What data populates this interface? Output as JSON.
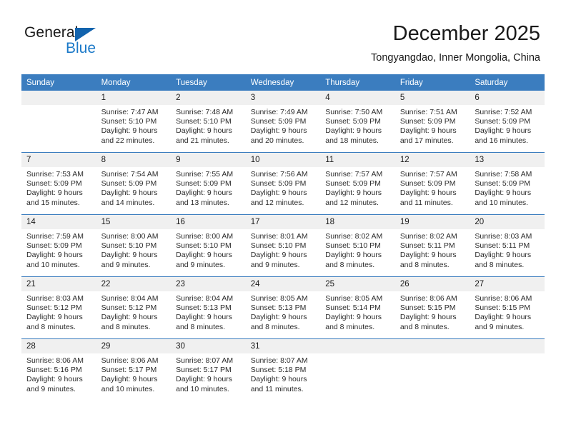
{
  "logo": {
    "word_one": "General",
    "word_two": "Blue",
    "triangle_color": "#1263ad",
    "blue_text_color": "#1b79c8"
  },
  "header": {
    "month_title": "December 2025",
    "location": "Tongyangdao, Inner Mongolia, China"
  },
  "theme": {
    "header_blue": "#3b7dbf",
    "daynum_band": "#f0f0f0",
    "text": "#2b2b2b"
  },
  "calendar": {
    "weekday_headers": [
      "Sunday",
      "Monday",
      "Tuesday",
      "Wednesday",
      "Thursday",
      "Friday",
      "Saturday"
    ],
    "weeks": [
      [
        {
          "day": "",
          "sunrise": "",
          "sunset": "",
          "daylight1": "",
          "daylight2": "",
          "empty": true
        },
        {
          "day": "1",
          "sunrise": "Sunrise: 7:47 AM",
          "sunset": "Sunset: 5:10 PM",
          "daylight1": "Daylight: 9 hours",
          "daylight2": "and 22 minutes."
        },
        {
          "day": "2",
          "sunrise": "Sunrise: 7:48 AM",
          "sunset": "Sunset: 5:10 PM",
          "daylight1": "Daylight: 9 hours",
          "daylight2": "and 21 minutes."
        },
        {
          "day": "3",
          "sunrise": "Sunrise: 7:49 AM",
          "sunset": "Sunset: 5:09 PM",
          "daylight1": "Daylight: 9 hours",
          "daylight2": "and 20 minutes."
        },
        {
          "day": "4",
          "sunrise": "Sunrise: 7:50 AM",
          "sunset": "Sunset: 5:09 PM",
          "daylight1": "Daylight: 9 hours",
          "daylight2": "and 18 minutes."
        },
        {
          "day": "5",
          "sunrise": "Sunrise: 7:51 AM",
          "sunset": "Sunset: 5:09 PM",
          "daylight1": "Daylight: 9 hours",
          "daylight2": "and 17 minutes."
        },
        {
          "day": "6",
          "sunrise": "Sunrise: 7:52 AM",
          "sunset": "Sunset: 5:09 PM",
          "daylight1": "Daylight: 9 hours",
          "daylight2": "and 16 minutes."
        }
      ],
      [
        {
          "day": "7",
          "sunrise": "Sunrise: 7:53 AM",
          "sunset": "Sunset: 5:09 PM",
          "daylight1": "Daylight: 9 hours",
          "daylight2": "and 15 minutes."
        },
        {
          "day": "8",
          "sunrise": "Sunrise: 7:54 AM",
          "sunset": "Sunset: 5:09 PM",
          "daylight1": "Daylight: 9 hours",
          "daylight2": "and 14 minutes."
        },
        {
          "day": "9",
          "sunrise": "Sunrise: 7:55 AM",
          "sunset": "Sunset: 5:09 PM",
          "daylight1": "Daylight: 9 hours",
          "daylight2": "and 13 minutes."
        },
        {
          "day": "10",
          "sunrise": "Sunrise: 7:56 AM",
          "sunset": "Sunset: 5:09 PM",
          "daylight1": "Daylight: 9 hours",
          "daylight2": "and 12 minutes."
        },
        {
          "day": "11",
          "sunrise": "Sunrise: 7:57 AM",
          "sunset": "Sunset: 5:09 PM",
          "daylight1": "Daylight: 9 hours",
          "daylight2": "and 12 minutes."
        },
        {
          "day": "12",
          "sunrise": "Sunrise: 7:57 AM",
          "sunset": "Sunset: 5:09 PM",
          "daylight1": "Daylight: 9 hours",
          "daylight2": "and 11 minutes."
        },
        {
          "day": "13",
          "sunrise": "Sunrise: 7:58 AM",
          "sunset": "Sunset: 5:09 PM",
          "daylight1": "Daylight: 9 hours",
          "daylight2": "and 10 minutes."
        }
      ],
      [
        {
          "day": "14",
          "sunrise": "Sunrise: 7:59 AM",
          "sunset": "Sunset: 5:09 PM",
          "daylight1": "Daylight: 9 hours",
          "daylight2": "and 10 minutes."
        },
        {
          "day": "15",
          "sunrise": "Sunrise: 8:00 AM",
          "sunset": "Sunset: 5:10 PM",
          "daylight1": "Daylight: 9 hours",
          "daylight2": "and 9 minutes."
        },
        {
          "day": "16",
          "sunrise": "Sunrise: 8:00 AM",
          "sunset": "Sunset: 5:10 PM",
          "daylight1": "Daylight: 9 hours",
          "daylight2": "and 9 minutes."
        },
        {
          "day": "17",
          "sunrise": "Sunrise: 8:01 AM",
          "sunset": "Sunset: 5:10 PM",
          "daylight1": "Daylight: 9 hours",
          "daylight2": "and 9 minutes."
        },
        {
          "day": "18",
          "sunrise": "Sunrise: 8:02 AM",
          "sunset": "Sunset: 5:10 PM",
          "daylight1": "Daylight: 9 hours",
          "daylight2": "and 8 minutes."
        },
        {
          "day": "19",
          "sunrise": "Sunrise: 8:02 AM",
          "sunset": "Sunset: 5:11 PM",
          "daylight1": "Daylight: 9 hours",
          "daylight2": "and 8 minutes."
        },
        {
          "day": "20",
          "sunrise": "Sunrise: 8:03 AM",
          "sunset": "Sunset: 5:11 PM",
          "daylight1": "Daylight: 9 hours",
          "daylight2": "and 8 minutes."
        }
      ],
      [
        {
          "day": "21",
          "sunrise": "Sunrise: 8:03 AM",
          "sunset": "Sunset: 5:12 PM",
          "daylight1": "Daylight: 9 hours",
          "daylight2": "and 8 minutes."
        },
        {
          "day": "22",
          "sunrise": "Sunrise: 8:04 AM",
          "sunset": "Sunset: 5:12 PM",
          "daylight1": "Daylight: 9 hours",
          "daylight2": "and 8 minutes."
        },
        {
          "day": "23",
          "sunrise": "Sunrise: 8:04 AM",
          "sunset": "Sunset: 5:13 PM",
          "daylight1": "Daylight: 9 hours",
          "daylight2": "and 8 minutes."
        },
        {
          "day": "24",
          "sunrise": "Sunrise: 8:05 AM",
          "sunset": "Sunset: 5:13 PM",
          "daylight1": "Daylight: 9 hours",
          "daylight2": "and 8 minutes."
        },
        {
          "day": "25",
          "sunrise": "Sunrise: 8:05 AM",
          "sunset": "Sunset: 5:14 PM",
          "daylight1": "Daylight: 9 hours",
          "daylight2": "and 8 minutes."
        },
        {
          "day": "26",
          "sunrise": "Sunrise: 8:06 AM",
          "sunset": "Sunset: 5:15 PM",
          "daylight1": "Daylight: 9 hours",
          "daylight2": "and 8 minutes."
        },
        {
          "day": "27",
          "sunrise": "Sunrise: 8:06 AM",
          "sunset": "Sunset: 5:15 PM",
          "daylight1": "Daylight: 9 hours",
          "daylight2": "and 9 minutes."
        }
      ],
      [
        {
          "day": "28",
          "sunrise": "Sunrise: 8:06 AM",
          "sunset": "Sunset: 5:16 PM",
          "daylight1": "Daylight: 9 hours",
          "daylight2": "and 9 minutes."
        },
        {
          "day": "29",
          "sunrise": "Sunrise: 8:06 AM",
          "sunset": "Sunset: 5:17 PM",
          "daylight1": "Daylight: 9 hours",
          "daylight2": "and 10 minutes."
        },
        {
          "day": "30",
          "sunrise": "Sunrise: 8:07 AM",
          "sunset": "Sunset: 5:17 PM",
          "daylight1": "Daylight: 9 hours",
          "daylight2": "and 10 minutes."
        },
        {
          "day": "31",
          "sunrise": "Sunrise: 8:07 AM",
          "sunset": "Sunset: 5:18 PM",
          "daylight1": "Daylight: 9 hours",
          "daylight2": "and 11 minutes."
        },
        {
          "day": "",
          "sunrise": "",
          "sunset": "",
          "daylight1": "",
          "daylight2": "",
          "empty": true
        },
        {
          "day": "",
          "sunrise": "",
          "sunset": "",
          "daylight1": "",
          "daylight2": "",
          "empty": true
        },
        {
          "day": "",
          "sunrise": "",
          "sunset": "",
          "daylight1": "",
          "daylight2": "",
          "empty": true
        }
      ]
    ]
  }
}
